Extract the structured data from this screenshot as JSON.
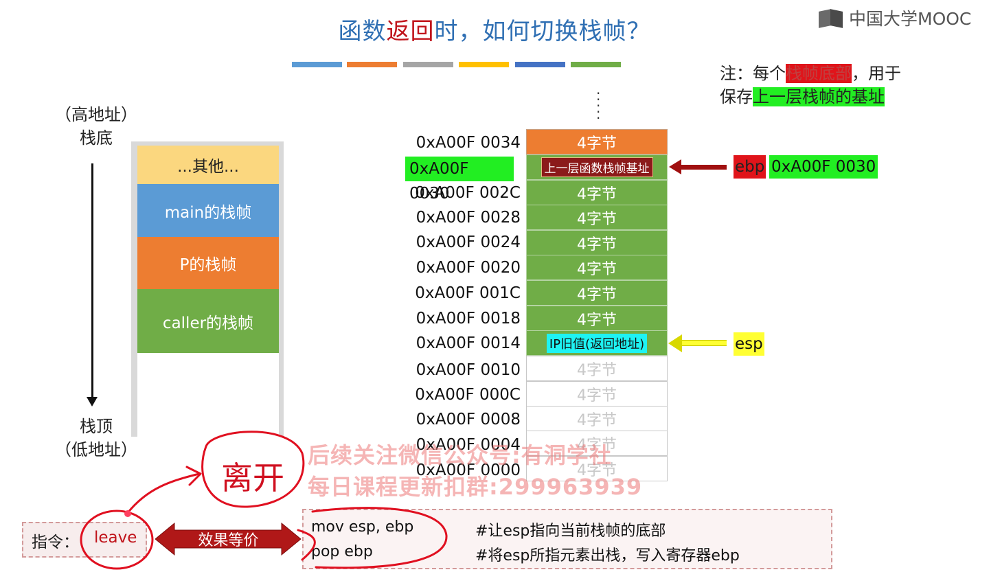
{
  "title": {
    "part1": "函数",
    "part2": "返回",
    "part3": "时，如何切换栈帧？"
  },
  "brand": {
    "text": "中国大学MOOC",
    "icon": "mooc-logo-icon"
  },
  "colors": {
    "bar1": "#5b9bd5",
    "bar2": "#ed7d31",
    "bar3": "#a5a5a5",
    "bar4": "#ffc000",
    "bar5": "#4472c4",
    "bar6": "#70ad47"
  },
  "note": {
    "prefix": "注：每个",
    "highlight1": "栈帧底部",
    "suffix1": "，用于",
    "line2_prefix": "保存",
    "highlight2": "上一层栈帧的基址"
  },
  "stack_diagram": {
    "top_label_1": "（高地址）",
    "top_label_2": "栈底",
    "bottom_label_1": "栈顶",
    "bottom_label_2": "（低地址）",
    "blocks": [
      {
        "label": "...其他..."
      },
      {
        "label": "main的栈帧"
      },
      {
        "label": "P的栈帧"
      },
      {
        "label": "caller的栈帧"
      }
    ]
  },
  "memory": {
    "dots": "⋮",
    "rows": [
      {
        "address": "0xA00F 0034",
        "content": "4字节"
      },
      {
        "address": "0xA00F 0030",
        "content": "上一层函数栈帧基址"
      },
      {
        "address": "0xA00F 002C",
        "content": "4字节"
      },
      {
        "address": "0xA00F 0028",
        "content": "4字节"
      },
      {
        "address": "0xA00F 0024",
        "content": "4字节"
      },
      {
        "address": "0xA00F 0020",
        "content": "4字节"
      },
      {
        "address": "0xA00F 001C",
        "content": "4字节"
      },
      {
        "address": "0xA00F 0018",
        "content": "4字节"
      },
      {
        "address": "0xA00F 0014",
        "content": "IP旧值(返回地址)"
      },
      {
        "address": "0xA00F 0010",
        "content": "4字节"
      },
      {
        "address": "0xA00F 000C",
        "content": "4字节"
      },
      {
        "address": "0xA00F 0008",
        "content": "4字节"
      },
      {
        "address": "0xA00F 0004",
        "content": "4字节"
      },
      {
        "address": "0xA00F 0000",
        "content": "4字节"
      }
    ]
  },
  "pointers": {
    "ebp_label": "ebp",
    "ebp_value": "0xA00F 0030",
    "esp_label": "esp"
  },
  "watermark": {
    "line1": "后续关注微信公众号:有洞学社",
    "line2": "每日课程更新扣群:299963939"
  },
  "annotation": {
    "handwritten": "离开"
  },
  "instruction": {
    "label": "指令：",
    "value": "leave",
    "equiv": "效果等价",
    "code": [
      {
        "op": "mov esp, ebp",
        "comment": "#让esp指向当前栈帧的底部"
      },
      {
        "op": "pop ebp",
        "comment": "#将esp所指元素出栈，写入寄存器ebp"
      }
    ]
  }
}
